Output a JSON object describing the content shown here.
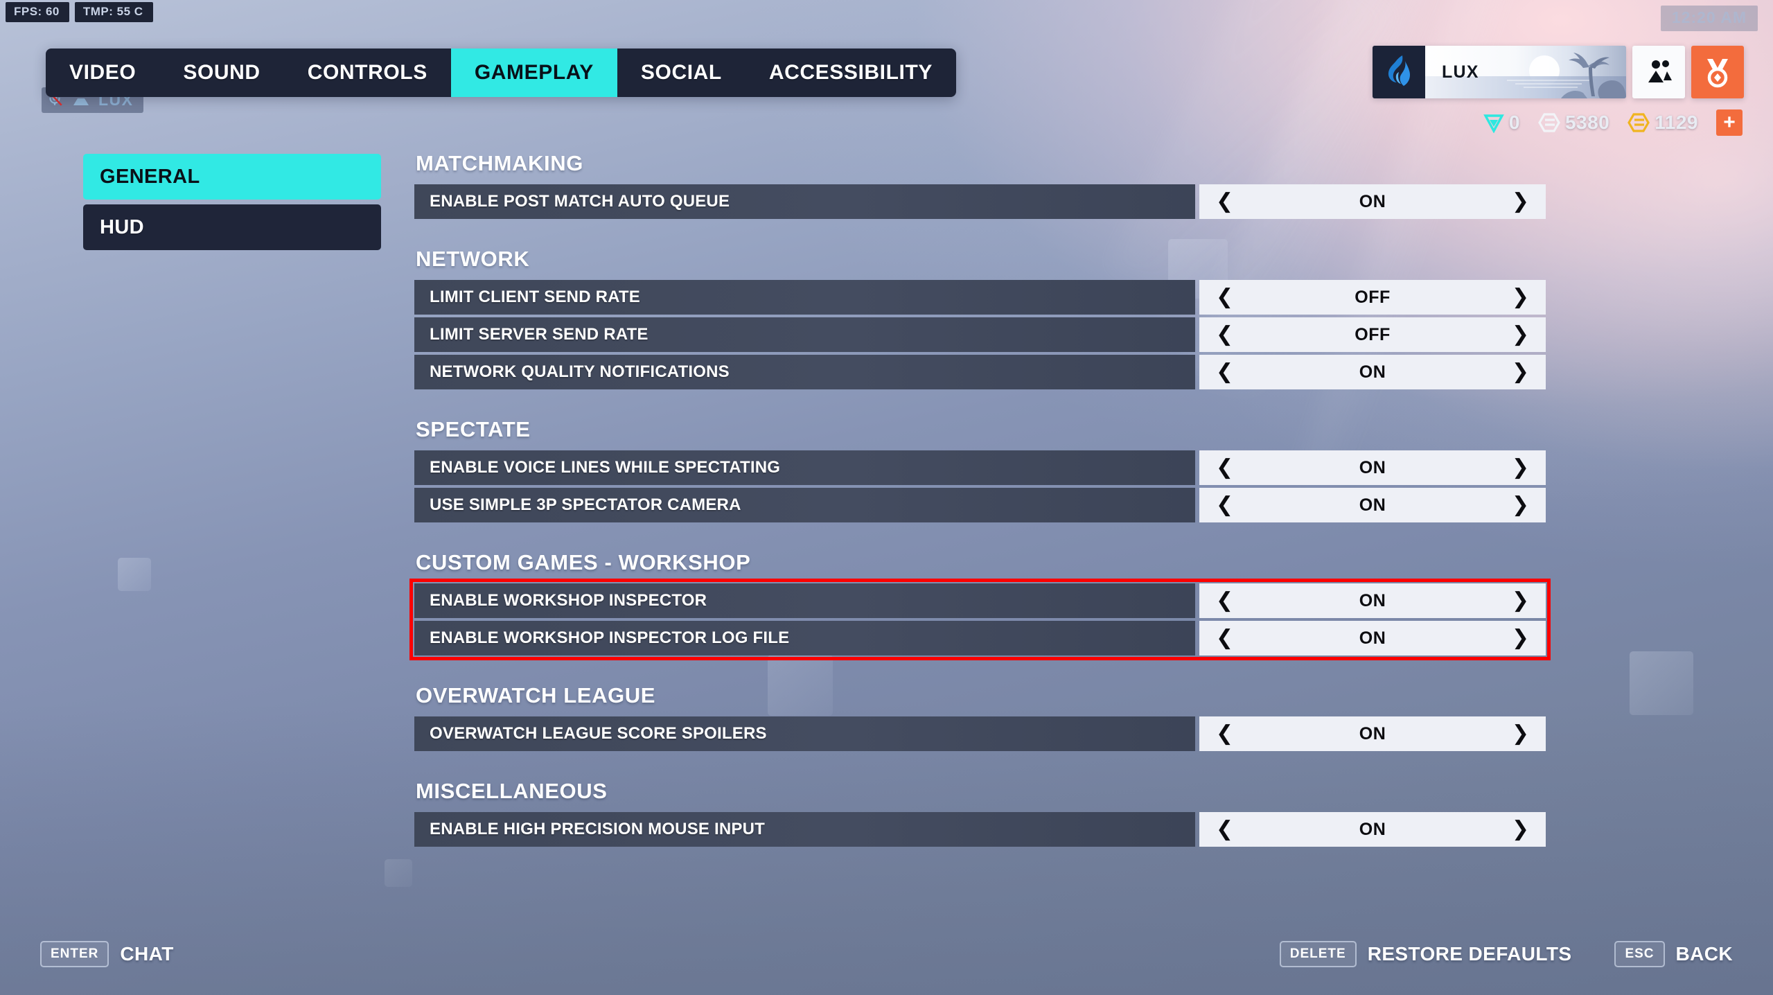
{
  "perf_overlay": {
    "fps": "FPS:  60",
    "temp": "TMP:  55 C"
  },
  "clock": "12:20 AM",
  "voice_strip": {
    "name": "LUX",
    "mic_icon": "mic-muted-icon",
    "group_icon": "voice-group-icon"
  },
  "tabs": [
    {
      "label": "VIDEO",
      "active": false
    },
    {
      "label": "SOUND",
      "active": false
    },
    {
      "label": "CONTROLS",
      "active": false
    },
    {
      "label": "GAMEPLAY",
      "active": true
    },
    {
      "label": "SOCIAL",
      "active": false
    },
    {
      "label": "ACCESSIBILITY",
      "active": false
    }
  ],
  "sidebar": {
    "items": [
      {
        "label": "GENERAL",
        "active": true
      },
      {
        "label": "HUD",
        "active": false
      }
    ]
  },
  "settings": {
    "chevron_left": "❮",
    "chevron_right": "❯",
    "sections": [
      {
        "title": "MATCHMAKING",
        "highlighted": false,
        "rows": [
          {
            "label": "ENABLE POST MATCH AUTO QUEUE",
            "value": "ON"
          }
        ]
      },
      {
        "title": "NETWORK",
        "highlighted": false,
        "rows": [
          {
            "label": "LIMIT CLIENT SEND RATE",
            "value": "OFF"
          },
          {
            "label": "LIMIT SERVER SEND RATE",
            "value": "OFF"
          },
          {
            "label": "NETWORK QUALITY NOTIFICATIONS",
            "value": "ON"
          }
        ]
      },
      {
        "title": "SPECTATE",
        "highlighted": false,
        "rows": [
          {
            "label": "ENABLE VOICE LINES WHILE SPECTATING",
            "value": "ON"
          },
          {
            "label": "USE SIMPLE 3P SPECTATOR CAMERA",
            "value": "ON"
          }
        ]
      },
      {
        "title": "CUSTOM GAMES - WORKSHOP",
        "highlighted": true,
        "highlight_color": "#fb0000",
        "rows": [
          {
            "label": "ENABLE WORKSHOP INSPECTOR",
            "value": "ON"
          },
          {
            "label": "ENABLE WORKSHOP INSPECTOR LOG FILE",
            "value": "ON"
          }
        ]
      },
      {
        "title": "OVERWATCH LEAGUE",
        "highlighted": false,
        "rows": [
          {
            "label": "OVERWATCH LEAGUE SCORE SPOILERS",
            "value": "ON"
          }
        ]
      },
      {
        "title": "MISCELLANEOUS",
        "highlighted": false,
        "rows": [
          {
            "label": "ENABLE HIGH PRECISION MOUSE INPUT",
            "value": "ON"
          }
        ]
      }
    ]
  },
  "player": {
    "name": "LUX",
    "player_icon": "blue-flame-icon",
    "namecard_art": "beach-sunset-palm-namecard",
    "social_button_icon": "friends-group-icon",
    "battlepass_button_icon": "medal-icon",
    "currencies": [
      {
        "name": "competitive-points",
        "icon": "cyan-triangle-icon",
        "amount": "0",
        "color": "#2ee8e0"
      },
      {
        "name": "overwatch-coins",
        "icon": "white-hex-coin-icon",
        "amount": "5380",
        "color": "#f2f4f8"
      },
      {
        "name": "legacy-credits",
        "icon": "gold-hex-coin-icon",
        "amount": "1129",
        "color": "#f0b41f"
      }
    ],
    "add_currency_label": "+"
  },
  "bottom_bar": {
    "left": [
      {
        "key": "ENTER",
        "label": "CHAT"
      }
    ],
    "right": [
      {
        "key": "DELETE",
        "label": "RESTORE DEFAULTS"
      },
      {
        "key": "ESC",
        "label": "BACK"
      }
    ]
  },
  "colors": {
    "accent_cyan": "#31e9e4",
    "panel_dark": "#1e2437",
    "row_dark": "#414960",
    "value_light": "#eef0f6",
    "highlight_red": "#fb0000",
    "orange": "#f36c3d"
  }
}
